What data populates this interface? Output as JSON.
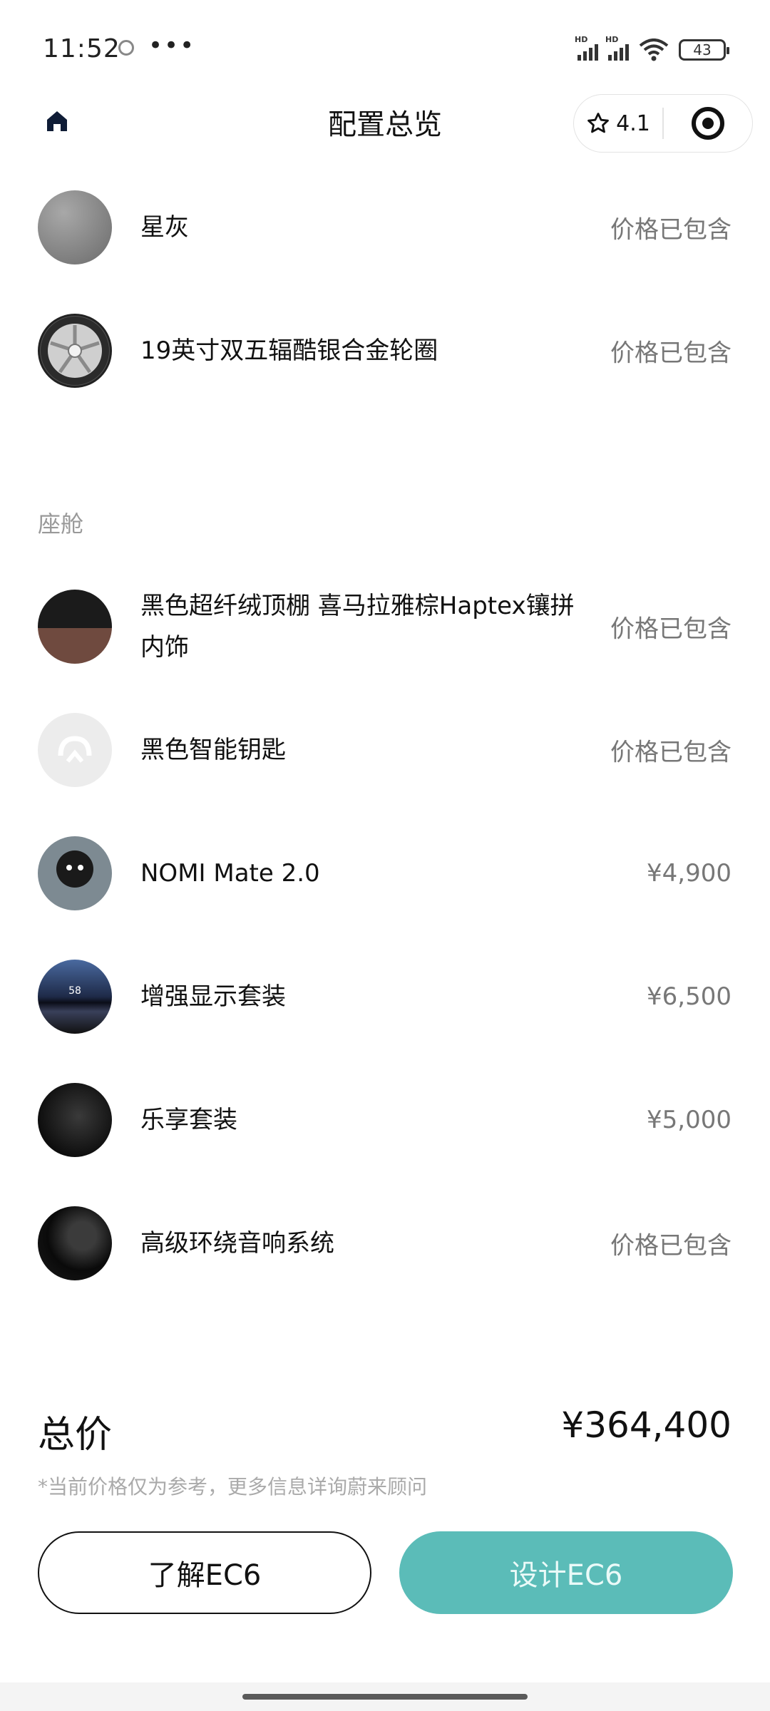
{
  "status_bar": {
    "time": "11:52",
    "network1": "HD",
    "network2": "HD",
    "battery": "43"
  },
  "header": {
    "title": "配置总览",
    "rating": "4.1"
  },
  "exterior_items": [
    {
      "label": "星灰",
      "price": "价格已包含",
      "thumb": "color-swatch-gray"
    },
    {
      "label": "19英寸双五辐酷银合金轮圈",
      "price": "价格已包含",
      "thumb": "wheel-image"
    }
  ],
  "cabin": {
    "section_title": "座舱",
    "items": [
      {
        "label": "黑色超纤绒顶棚 喜马拉雅棕Haptex镶拼内饰",
        "price": "价格已包含",
        "thumb": "interior-image"
      },
      {
        "label": "黑色智能钥匙",
        "price": "价格已包含",
        "thumb": "key-logo-icon"
      },
      {
        "label": "NOMI Mate 2.0",
        "price": "¥4,900",
        "thumb": "nomi-image"
      },
      {
        "label": "增强显示套装",
        "price": "¥6,500",
        "thumb": "hud-image",
        "thumb_text": "58"
      },
      {
        "label": "乐享套装",
        "price": "¥5,000",
        "thumb": "seat-image"
      },
      {
        "label": "高级环绕音响系统",
        "price": "价格已包含",
        "thumb": "speaker-image"
      }
    ]
  },
  "total": {
    "label": "总价",
    "value": "¥364,400",
    "disclaimer": "*当前价格仅为参考，更多信息详询蔚来顾问"
  },
  "buttons": {
    "learn": "了解EC6",
    "design": "设计EC6"
  },
  "colors": {
    "accent": "#5bbcb8",
    "text": "#111111",
    "muted": "#777777"
  }
}
